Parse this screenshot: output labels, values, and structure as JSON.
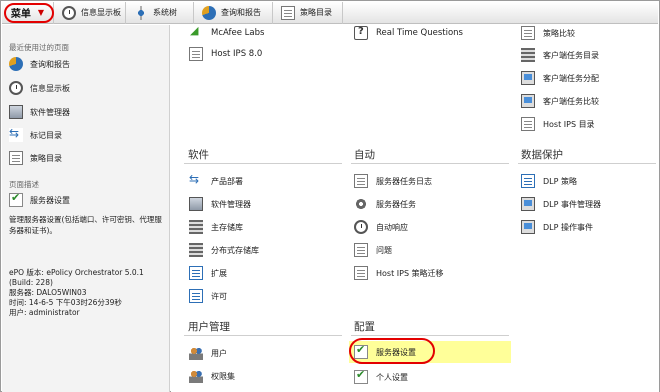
{
  "toolbar": {
    "menu_label": "菜单",
    "items": [
      "信息显示板",
      "系统树",
      "查询和报告",
      "策略目录"
    ]
  },
  "left_panel": {
    "recent_title": "最近使用过的页面",
    "recent_items": [
      "查询和报告",
      "信息显示板",
      "软件管理器",
      "标记目录",
      "策略目录"
    ],
    "page_desc_title": "页面描述",
    "page_name": "服务器设置",
    "page_desc": "管理服务器设置(包括端口、许可密钥、代理服务器和证书)。",
    "info": {
      "version": "ePO 版本: ePolicy Orchestrator 5.0.1",
      "build": "(Build: 228)",
      "server": "服务器: DALO5WIN03",
      "time": "时间: 14-6-5 下午03时26分39秒",
      "user": "用户: administrator"
    }
  },
  "main": {
    "top_col1": [
      "McAfee Labs",
      "Host IPS 8.0"
    ],
    "top_col2": [
      "Real Time Questions"
    ],
    "top_col3": [
      "策略比较",
      "客户端任务目录",
      "客户端任务分配",
      "客户端任务比较",
      "Host IPS 目录"
    ],
    "software": {
      "title": "软件",
      "items": [
        "产品部署",
        "软件管理器",
        "主存储库",
        "分布式存储库",
        "扩展",
        "许可"
      ]
    },
    "automation": {
      "title": "自动",
      "items": [
        "服务器任务日志",
        "服务器任务",
        "自动响应",
        "问题",
        "Host IPS 策略迁移"
      ]
    },
    "data_protection": {
      "title": "数据保护",
      "items": [
        "DLP 策略",
        "DLP 事件管理器",
        "DLP 操作事件"
      ]
    },
    "user_management": {
      "title": "用户管理",
      "items": [
        "用户",
        "权限集"
      ]
    },
    "configuration": {
      "title": "配置",
      "items": [
        "服务器设置",
        "个人设置"
      ]
    }
  },
  "colors": {
    "highlight": "#ffff99",
    "annotation": "#e30000"
  }
}
